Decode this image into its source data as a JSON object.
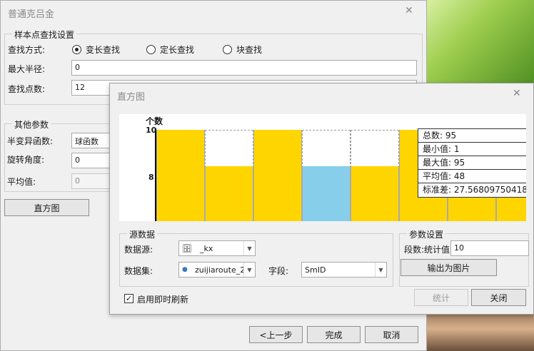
{
  "main": {
    "title": "普通克吕金",
    "sample_group": {
      "label": "样本点查找设置",
      "find_mode_label": "查找方式:",
      "modes": [
        "变长查找",
        "定长查找",
        "块查找"
      ],
      "selected_mode": "变长查找",
      "max_radius_label": "最大半径:",
      "max_radius_value": "0",
      "find_count_label": "查找点数:",
      "find_count_value": "12"
    },
    "other_group": {
      "label": "其他参数",
      "variogram_label": "半变异函数:",
      "variogram_value": "球函数",
      "rotation_label": "旋转角度:",
      "rotation_value": "0",
      "mean_label": "平均值:",
      "mean_value": "0"
    },
    "histogram_button": "直方图",
    "footer": {
      "prev": "<上一步",
      "finish": "完成",
      "cancel": "取消"
    }
  },
  "histogram": {
    "title": "直方图",
    "chart_data": {
      "type": "bar",
      "ylabel": "个数",
      "y_ticks": [
        "10",
        "8"
      ],
      "values": [
        10,
        9,
        10,
        9,
        9,
        10,
        10,
        10
      ],
      "highlight_index": 3,
      "bar_color": "#ffd500",
      "highlight_color": "#87ceeb",
      "stats": {
        "total": "总数: 95",
        "min": "最小值: 1",
        "max": "最大值: 95",
        "mean": "平均值: 48",
        "stddev": "标准差: 27.568097504180"
      }
    },
    "source_group": {
      "label": "源数据",
      "datasource_label": "数据源:",
      "datasource_value": "_kx",
      "dataset_label": "数据集:",
      "dataset_value": "zuijiaroute_2",
      "field_label": "字段:",
      "field_value": "SmID"
    },
    "param_group": {
      "label": "参数设置",
      "segments_label": "段数:统计值",
      "segments_value": "10",
      "export_button": "输出为图片"
    },
    "realtime_label": "启用即时刷新",
    "realtime_checked": true,
    "stat_button": "统计",
    "close_button": "关闭"
  },
  "colors": {
    "bar": "#ffd500",
    "highlight": "#87ceeb"
  }
}
